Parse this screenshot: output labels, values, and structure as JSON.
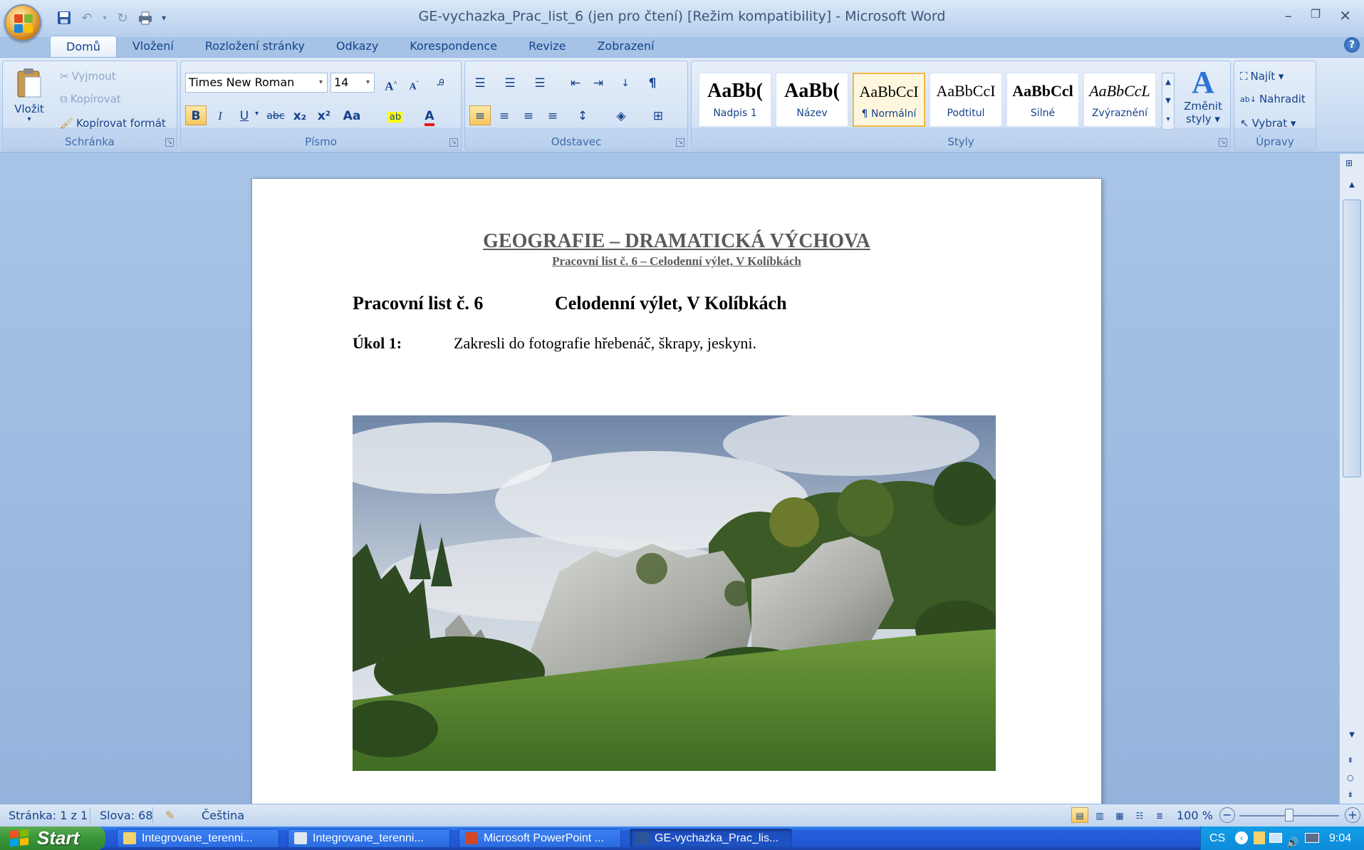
{
  "window": {
    "title": "GE-vychazka_Prac_list_6 (jen pro čtení) [Režim kompatibility] - Microsoft Word",
    "minimize_icon": "minimize-icon",
    "restore_icon": "restore-icon",
    "close_icon": "close-icon"
  },
  "quick_access": [
    "save-icon",
    "undo-icon",
    "redo-icon",
    "print-icon",
    "customize-icon"
  ],
  "tabs": [
    {
      "label": "Domů",
      "active": true
    },
    {
      "label": "Vložení"
    },
    {
      "label": "Rozložení stránky"
    },
    {
      "label": "Odkazy"
    },
    {
      "label": "Korespondence"
    },
    {
      "label": "Revize"
    },
    {
      "label": "Zobrazení"
    }
  ],
  "ribbon": {
    "clipboard": {
      "paste_label": "Vložit",
      "cut_label": "Vyjmout",
      "copy_label": "Kopírovat",
      "format_painter_label": "Kopírovat formát",
      "group_label": "Schránka"
    },
    "font": {
      "font_name": "Times New Roman",
      "font_size": "14",
      "group_label": "Písmo",
      "bold": "B",
      "italic": "I",
      "underline": "U",
      "strike": "abc",
      "subscript": "x₂",
      "superscript": "x²",
      "change_case": "Aa"
    },
    "paragraph": {
      "group_label": "Odstavec"
    },
    "styles": {
      "group_label": "Styly",
      "items": [
        {
          "sample": "AaBb(",
          "name": "Nadpis 1"
        },
        {
          "sample": "AaBb(",
          "name": "Název"
        },
        {
          "sample": "AaBbCcI",
          "name": "¶ Normální",
          "selected": true
        },
        {
          "sample": "AaBbCcI",
          "name": "Podtitul"
        },
        {
          "sample": "AaBbCcl",
          "name": "Silné"
        },
        {
          "sample": "AaBbCcL",
          "name": "Zvýraznění"
        }
      ],
      "change_styles_label_1": "Změnit",
      "change_styles_label_2": "styly ▾"
    },
    "editing": {
      "group_label": "Úpravy",
      "find_label": "Najít ▾",
      "replace_label": "Nahradit",
      "select_label": "Vybrat ▾"
    }
  },
  "document": {
    "header_title": "GEOGRAFIE – DRAMATICKÁ VÝCHOVA",
    "header_subtitle": "Pracovní list č. 6 – Celodenní výlet, V Kolíbkách",
    "heading_left": "Pracovní list č. 6",
    "heading_right": "Celodenní výlet, V Kolíbkách",
    "task_label": "Úkol 1:",
    "task_text": "Zakresli do fotografie hřebenáč, škrapy, jeskyni."
  },
  "statusbar": {
    "page": "Stránka: 1 z 1",
    "words": "Slova: 68",
    "language": "Čeština",
    "zoom": "100 %"
  },
  "taskbar": {
    "start_label": "Start",
    "items": [
      {
        "label": "Integrovane_terenni..."
      },
      {
        "label": "Integrovane_terenni..."
      },
      {
        "label": "Microsoft PowerPoint ..."
      },
      {
        "label": "GE-vychazka_Prac_lis...",
        "active": true
      }
    ],
    "lang": "CS",
    "clock": "9:04"
  }
}
